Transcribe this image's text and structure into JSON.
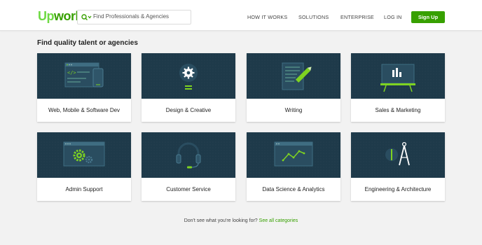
{
  "header": {
    "logo_up": "Up",
    "logo_rest": "work",
    "search_placeholder": "Find Professionals & Agencies",
    "nav": [
      "HOW IT WORKS",
      "SOLUTIONS",
      "ENTERPRISE",
      "LOG IN"
    ],
    "signup_label": "Sign Up"
  },
  "main": {
    "title": "Find quality talent or agencies",
    "categories": [
      {
        "label": "Web, Mobile & Software Dev",
        "icon": "code-window-icon"
      },
      {
        "label": "Design & Creative",
        "icon": "lightbulb-gear-icon"
      },
      {
        "label": "Writing",
        "icon": "pen-document-icon"
      },
      {
        "label": "Sales & Marketing",
        "icon": "presentation-board-icon"
      },
      {
        "label": "Admin Support",
        "icon": "gears-window-icon"
      },
      {
        "label": "Customer Service",
        "icon": "headset-icon"
      },
      {
        "label": "Data Science & Analytics",
        "icon": "line-chart-icon"
      },
      {
        "label": "Engineering & Architecture",
        "icon": "compass-icon"
      }
    ]
  },
  "footer": {
    "prompt": "Don't see what you're looking for?",
    "link": "See all categories"
  },
  "colors": {
    "brand_green": "#37a000",
    "logo_green": "#6fda44",
    "card_art_bg": "#1e3a4a",
    "accent_lime": "#7ed321"
  }
}
